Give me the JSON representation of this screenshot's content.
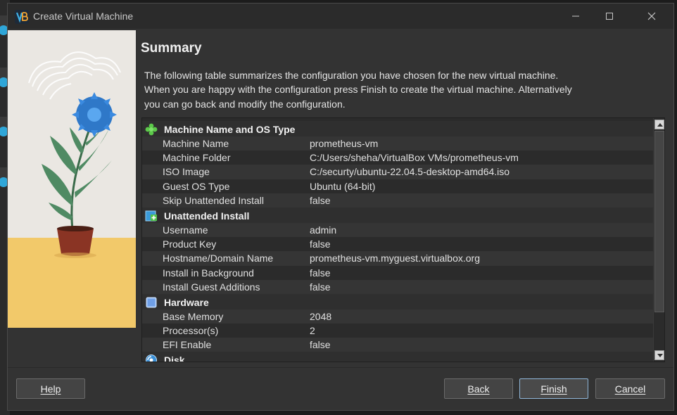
{
  "window": {
    "title": "Create Virtual Machine"
  },
  "page": {
    "heading": "Summary",
    "description_lines": [
      "The following table summarizes the configuration you have chosen for the new virtual machine.",
      "When you are happy with the configuration press Finish to create the virtual machine. Alternatively",
      "you can go back and modify the configuration."
    ]
  },
  "sections": [
    {
      "title": "Machine Name and OS Type",
      "icon": "puzzle-green-icon",
      "rows": [
        {
          "key": "Machine Name",
          "value": "prometheus-vm"
        },
        {
          "key": "Machine Folder",
          "value": "C:/Users/sheha/VirtualBox VMs/prometheus-vm"
        },
        {
          "key": "ISO Image",
          "value": "C:/securty/ubuntu-22.04.5-desktop-amd64.iso"
        },
        {
          "key": "Guest OS Type",
          "value": "Ubuntu (64-bit)"
        },
        {
          "key": "Skip Unattended Install",
          "value": "false"
        }
      ]
    },
    {
      "title": "Unattended Install",
      "icon": "install-add-icon",
      "rows": [
        {
          "key": "Username",
          "value": "admin"
        },
        {
          "key": "Product Key",
          "value": "false"
        },
        {
          "key": "Hostname/Domain Name",
          "value": "prometheus-vm.myguest.virtualbox.org"
        },
        {
          "key": "Install in Background",
          "value": "false"
        },
        {
          "key": "Install Guest Additions",
          "value": "false"
        }
      ]
    },
    {
      "title": "Hardware",
      "icon": "chip-icon",
      "rows": [
        {
          "key": "Base Memory",
          "value": "2048"
        },
        {
          "key": "Processor(s)",
          "value": "2"
        },
        {
          "key": "EFI Enable",
          "value": "false"
        }
      ]
    },
    {
      "title": "Disk",
      "icon": "disk-icon",
      "rows": []
    }
  ],
  "buttons": {
    "help": "Help",
    "back": "Back",
    "finish": "Finish",
    "cancel": "Cancel"
  },
  "colors": {
    "accent_blue": "#2fa6d8",
    "focus_border": "#8fb6d8",
    "dialog_bg": "#333333"
  }
}
